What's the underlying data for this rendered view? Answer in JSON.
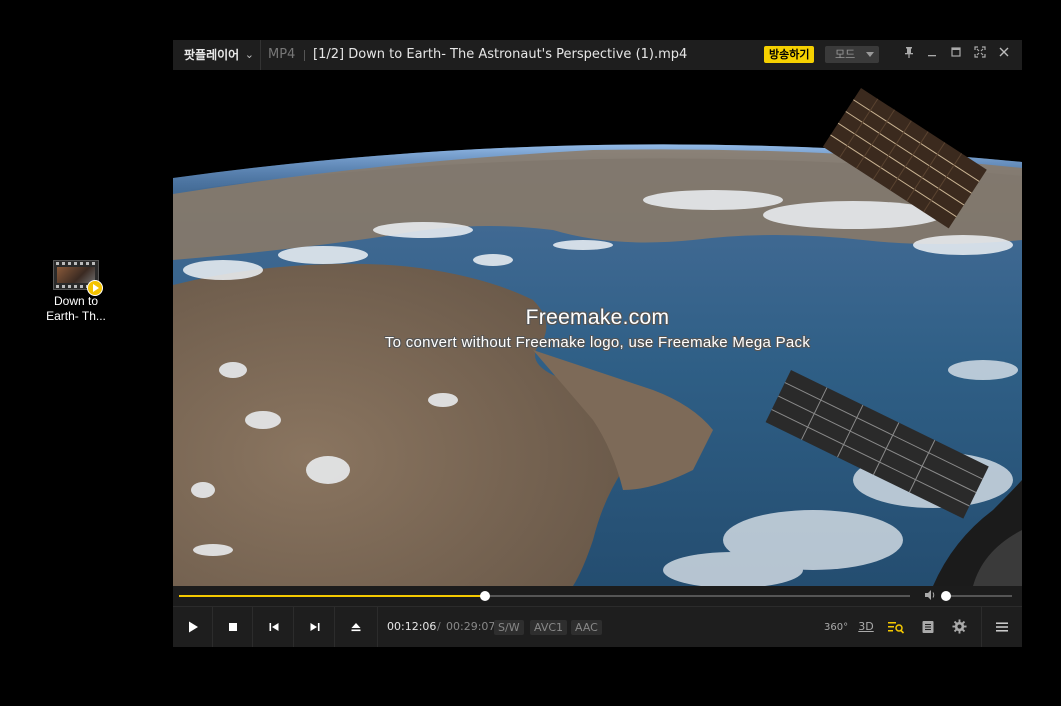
{
  "desktop": {
    "icon_label_line1": "Down to",
    "icon_label_line2": "Earth- Th..."
  },
  "player": {
    "brand": "팟플레이어",
    "format": "MP4",
    "title": "[1/2] Down to Earth- The Astronaut's Perspective (1).mp4",
    "broadcast_button": "방송하기",
    "mode_select": "모드",
    "watermark_title": "Freemake.com",
    "watermark_subtitle": "To convert without Freemake logo, use Freemake Mega Pack",
    "playback_progress": 0.418,
    "volume_level": 0.0,
    "time_current": "00:12:06",
    "time_separator": "/",
    "time_total": "00:29:07",
    "tags": [
      "S/W",
      "AVC1",
      "AAC"
    ],
    "labels": {
      "vr": "360°",
      "three_d": "3D"
    },
    "colors": {
      "accent": "#f5c900",
      "titlebar": "#1e1e1e"
    }
  }
}
